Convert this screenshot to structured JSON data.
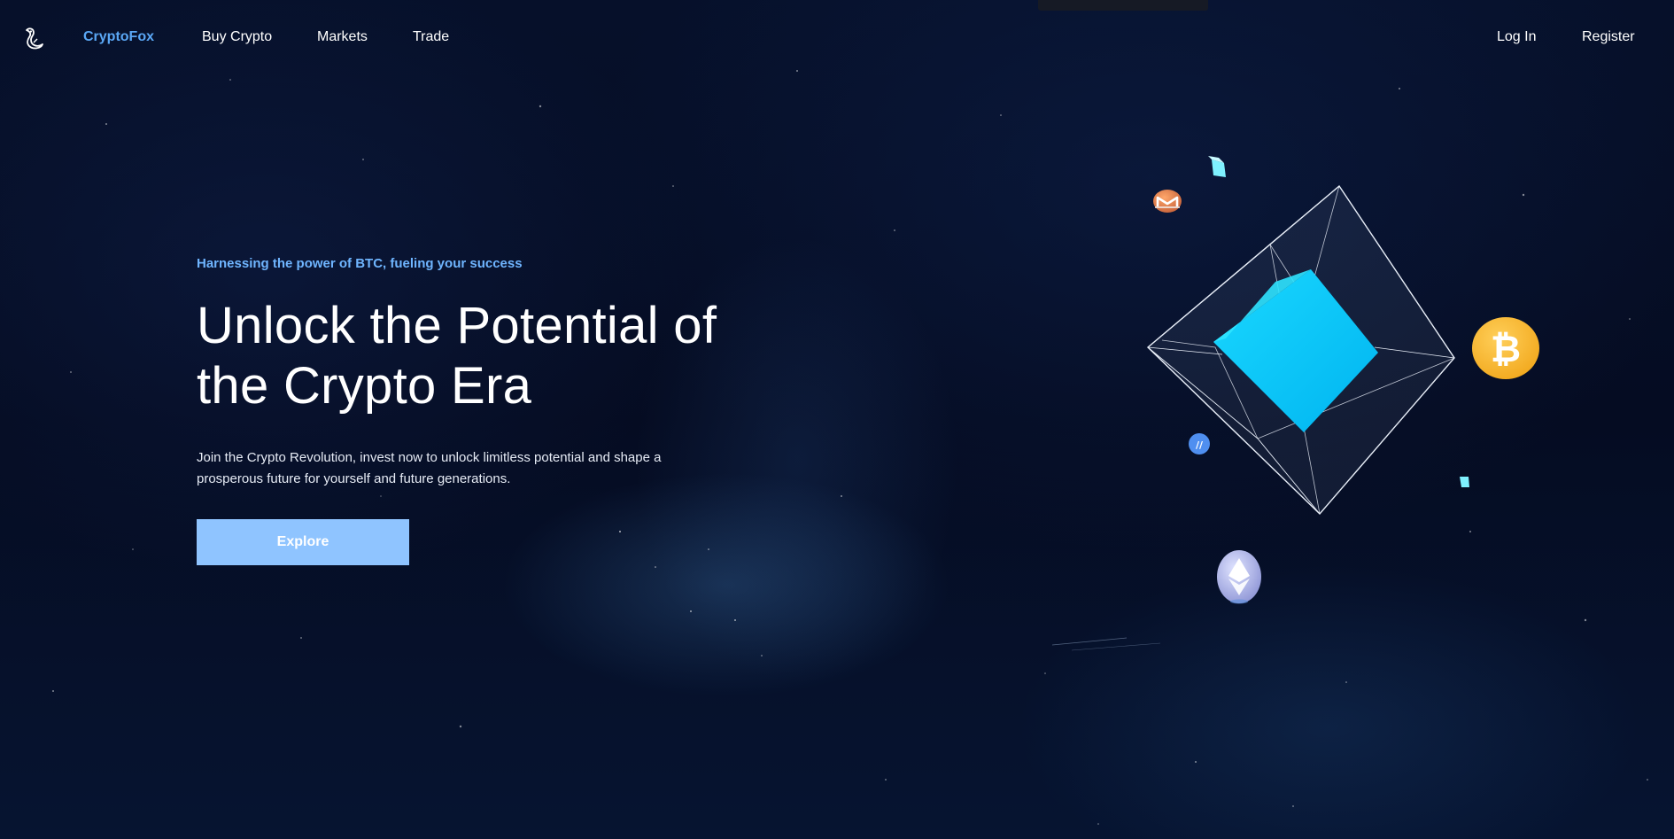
{
  "nav": {
    "logo_icon": "fox-logo-icon",
    "brand": "CryptoFox",
    "links": [
      "Buy Crypto",
      "Markets",
      "Trade"
    ],
    "login": "Log In",
    "register": "Register"
  },
  "hero": {
    "tagline": "Harnessing the power of BTC, fueling your success",
    "headline_line1": "Unlock the Potential of",
    "headline_line2": "the Crypto Era",
    "description_line1": "Join the Crypto Revolution, invest now to unlock limitless potential and shape a",
    "description_line2": "prosperous future for yourself and future generations.",
    "cta": "Explore"
  },
  "illustration": {
    "icons": [
      "monero-icon",
      "bitcoin-icon",
      "ethereum-icon",
      "coin-icon",
      "crystal-cube-icon"
    ]
  },
  "colors": {
    "background": "#050b1c",
    "brand": "#5aa7f5",
    "tagline": "#6fb5ff",
    "button": "#8fc4ff",
    "cube": "#00c8ff",
    "bitcoin": "#f7b731"
  }
}
